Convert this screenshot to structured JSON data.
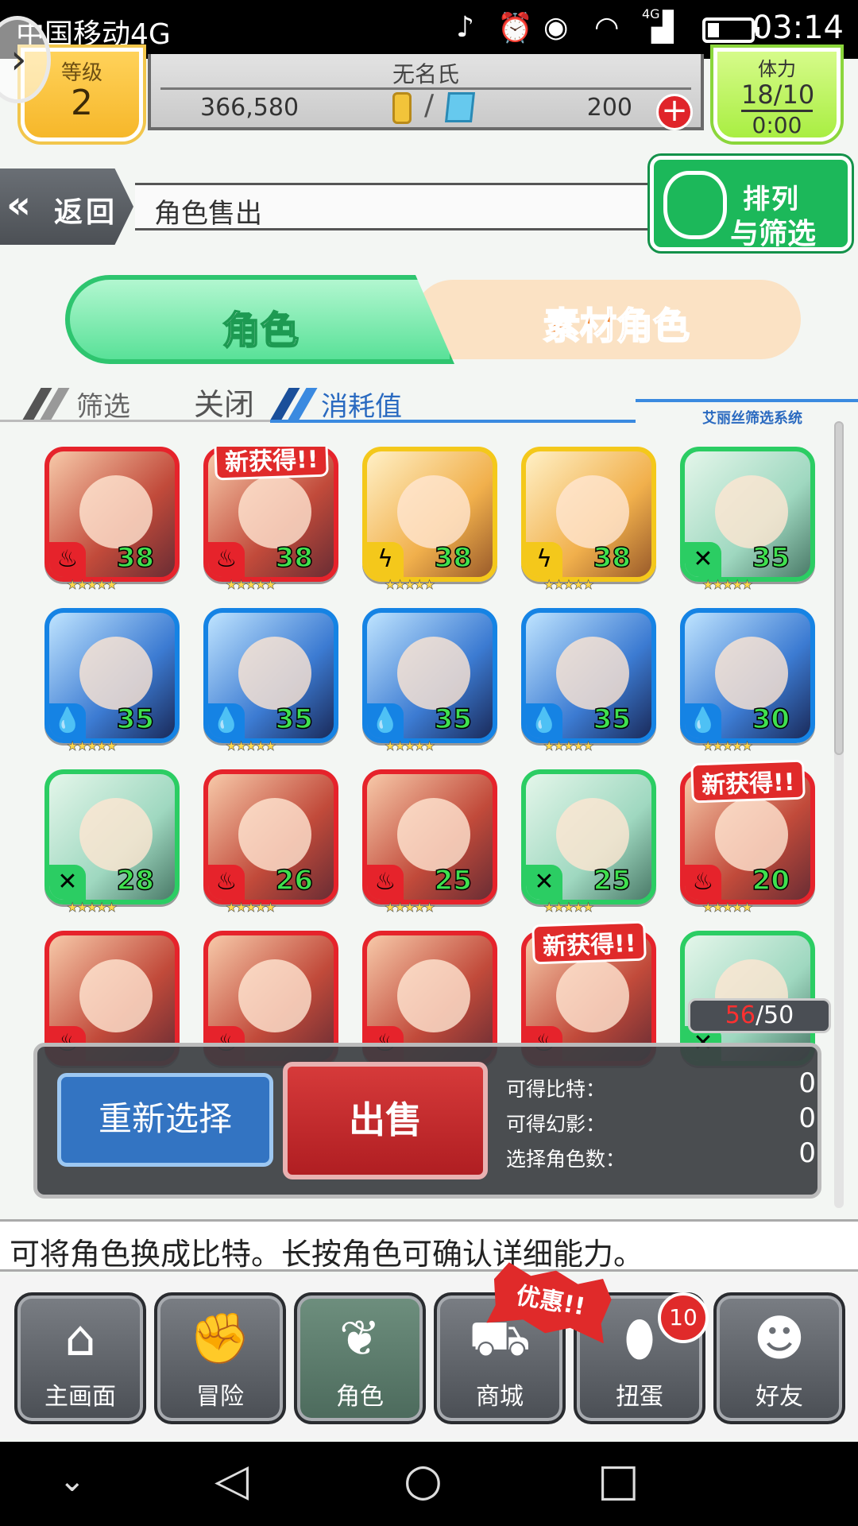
{
  "status_bar": {
    "carrier": "中国移动4G",
    "network": "4G",
    "time": "03:14"
  },
  "header": {
    "level_label": "等级",
    "level_value": "2",
    "player_name": "无名氏",
    "coins": "366,580",
    "separator": "/",
    "gems": "200",
    "stamina_label": "体力",
    "stamina_value": "18/10",
    "stamina_timer": "0:00"
  },
  "titlebar": {
    "back_label": "返回",
    "title": "角色售出",
    "sort_line1": "排列",
    "sort_line2": "与筛选"
  },
  "tabs": [
    {
      "label": "角色",
      "active": true
    },
    {
      "label": "素材角色",
      "active": false
    }
  ],
  "filter": {
    "filter_label": "筛选",
    "filter_value": "关闭",
    "sort_label": "消耗值",
    "system_label": "艾丽丝筛选系统"
  },
  "characters": [
    {
      "color": "red",
      "attr": "fire",
      "level": "38",
      "new": false
    },
    {
      "color": "red",
      "attr": "fire",
      "level": "38",
      "new": true
    },
    {
      "color": "yellow",
      "attr": "thunder",
      "level": "38",
      "new": false
    },
    {
      "color": "yellow",
      "attr": "thunder",
      "level": "38",
      "new": false
    },
    {
      "color": "green",
      "attr": "wind",
      "level": "35",
      "new": false
    },
    {
      "color": "blue",
      "attr": "water",
      "level": "35",
      "new": false
    },
    {
      "color": "blue",
      "attr": "water",
      "level": "35",
      "new": false
    },
    {
      "color": "blue",
      "attr": "water",
      "level": "35",
      "new": false
    },
    {
      "color": "blue",
      "attr": "water",
      "level": "35",
      "new": false
    },
    {
      "color": "blue",
      "attr": "water",
      "level": "30",
      "new": false
    },
    {
      "color": "green",
      "attr": "wind",
      "level": "28",
      "new": false
    },
    {
      "color": "red",
      "attr": "fire",
      "level": "26",
      "new": false
    },
    {
      "color": "red",
      "attr": "fire",
      "level": "25",
      "new": false
    },
    {
      "color": "green",
      "attr": "wind",
      "level": "25",
      "new": false
    },
    {
      "color": "red",
      "attr": "fire",
      "level": "20",
      "new": true
    },
    {
      "color": "red",
      "attr": "fire",
      "level": "",
      "new": false
    },
    {
      "color": "red",
      "attr": "fire",
      "level": "",
      "new": false
    },
    {
      "color": "red",
      "attr": "fire",
      "level": "",
      "new": false
    },
    {
      "color": "red",
      "attr": "fire",
      "level": "",
      "new": true
    },
    {
      "color": "green",
      "attr": "wind",
      "level": "",
      "new": false
    }
  ],
  "new_tag": "新获得!!",
  "star_rating": "★★★★★",
  "count": {
    "current": "56",
    "max": "/50"
  },
  "sell_panel": {
    "reselect_label": "重新选择",
    "sell_label": "出售",
    "bits_label": "可得比特：",
    "bits_value": "0",
    "phantom_label": "可得幻影：",
    "phantom_value": "0",
    "selected_label": "选择角色数：",
    "selected_value": "0"
  },
  "hint": "可将角色换成比特。长按角色可确认详细能力。",
  "nav": [
    {
      "label": "主画面",
      "icon": "home-icon"
    },
    {
      "label": "冒险",
      "icon": "handshake-icon"
    },
    {
      "label": "角色",
      "icon": "rabbit-icon",
      "active": true
    },
    {
      "label": "商城",
      "icon": "cart-icon"
    },
    {
      "label": "扭蛋",
      "icon": "egg-icon"
    },
    {
      "label": "好友",
      "icon": "friends-icon"
    }
  ],
  "promo_label": "优惠!!",
  "gacha_badge": "10",
  "colors": {
    "fire": "#e6232b",
    "thunder": "#f4c81b",
    "wind": "#2bcd63",
    "water": "#1583e4",
    "accent_green": "#2ec56f"
  }
}
